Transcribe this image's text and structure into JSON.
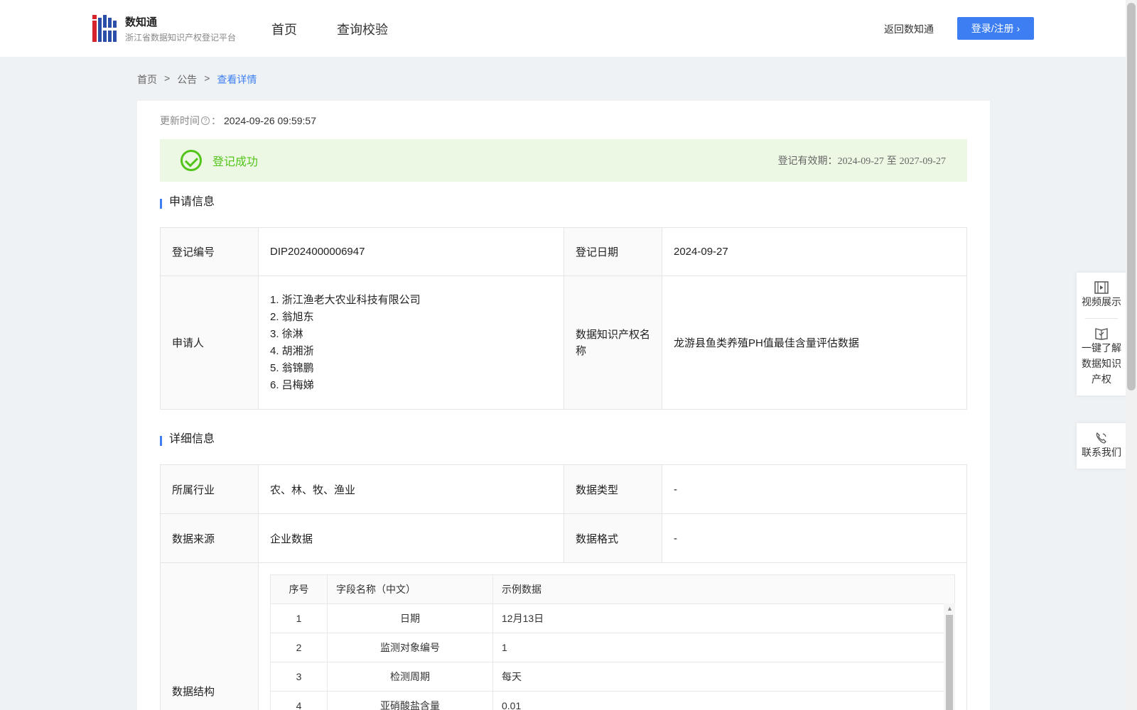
{
  "header": {
    "logo_title": "数知通",
    "logo_subtitle": "浙江省数据知识产权登记平台",
    "nav": [
      "首页",
      "查询校验"
    ],
    "back_link": "返回数知通",
    "login_label": "登录/注册"
  },
  "breadcrumb": {
    "items": [
      "首页",
      "公告"
    ],
    "separator": ">",
    "current": "查看详情"
  },
  "update": {
    "label": "更新时间",
    "help_icon": "?",
    "colon": "：",
    "value": "2024-09-26 09:59:57"
  },
  "status": {
    "text": "登记成功",
    "validity_label": "登记有效期：",
    "validity_start": "2024-09-27",
    "validity_to": "至",
    "validity_end": "2027-09-27",
    "color": "#52c41a"
  },
  "application": {
    "section_title": "申请信息",
    "reg_no_label": "登记编号",
    "reg_no": "DIP2024000006947",
    "reg_date_label": "登记日期",
    "reg_date": "2024-09-27",
    "applicant_label": "申请人",
    "applicants": [
      "1. 浙江渔老大农业科技有限公司",
      "2. 翁旭东",
      "3. 徐淋",
      "4. 胡湘浙",
      "5. 翁锦鹏",
      "6. 吕梅娣"
    ],
    "ip_name_label": "数据知识产权名称",
    "ip_name": "龙游县鱼类养殖PH值最佳含量评估数据"
  },
  "details": {
    "section_title": "详细信息",
    "industry_label": "所属行业",
    "industry": "农、林、牧、渔业",
    "data_type_label": "数据类型",
    "data_type": "-",
    "data_source_label": "数据来源",
    "data_source": "企业数据",
    "data_format_label": "数据格式",
    "data_format": "-",
    "structure_label": "数据结构",
    "structure_headers": [
      "序号",
      "字段名称（中文）",
      "示例数据"
    ],
    "structure_rows": [
      [
        "1",
        "日期",
        "12月13日"
      ],
      [
        "2",
        "监测对象编号",
        "1"
      ],
      [
        "3",
        "检测周期",
        "每天"
      ],
      [
        "4",
        "亚硝酸盐含量",
        "0.01"
      ]
    ]
  },
  "float_panel": {
    "video_label": "视频展示",
    "learn_label": "一键了解数据知识产权",
    "contact_label": "联系我们"
  },
  "colors": {
    "primary": "#3d7ff2",
    "success": "#52c41a",
    "success_bg": "#ecf8e4",
    "page_bg": "#eff2f5"
  }
}
